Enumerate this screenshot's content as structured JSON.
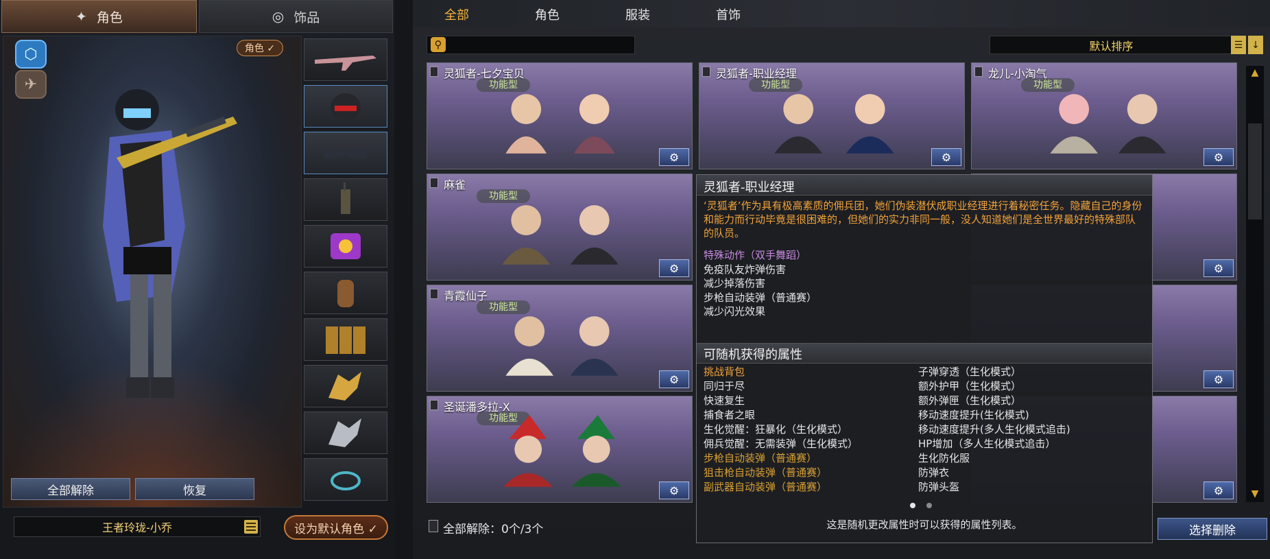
{
  "left_tabs": {
    "role": "角色",
    "accessory": "饰品"
  },
  "role_badge": "角色 ✓",
  "buttons": {
    "unequip_all": "全部解除",
    "restore": "恢复",
    "set_default": "设为默认角色 ✓",
    "select_delete": "选择删除"
  },
  "char_name": "王者玲珑-小乔",
  "nav": {
    "all": "全部",
    "role": "角色",
    "clothing": "服装",
    "accessory": "首饰"
  },
  "search": {
    "placeholder": ""
  },
  "sort": {
    "label": "默认排序"
  },
  "cards": [
    {
      "title": "灵狐者-七夕宝贝",
      "tag": "功能型"
    },
    {
      "title": "灵狐者-职业经理",
      "tag": "功能型"
    },
    {
      "title": "龙儿-小淘气",
      "tag": "功能型"
    },
    {
      "title": "麻雀",
      "tag": "功能型"
    },
    {
      "title": "青霞仙子",
      "tag": "功能型"
    },
    {
      "title": "圣诞潘多拉-X",
      "tag": "功能型"
    }
  ],
  "bottom_status": "全部解除：0个/3个",
  "tooltip": {
    "title": "灵狐者-职业经理",
    "description": "‘灵狐者’作为具有极高素质的佣兵团，她们伪装潜伏成职业经理进行着秘密任务。隐藏自己的身份和能力而行动毕竟是很困难的，但她们的实力非同一般，没人知道她们是全世界最好的特殊部队的队员。",
    "special_action": "特殊动作（双手舞蹈）",
    "features": [
      "免疫队友炸弹伤害",
      "减少掉落伤害",
      "步枪自动装弹（普通赛）",
      "减少闪光效果"
    ],
    "random_attr_title": "可随机获得的属性",
    "random_attrs_left": [
      {
        "text": "挑战背包",
        "color": "#f2a33a"
      },
      {
        "text": "同归于尽",
        "color": "#e6e6e6"
      },
      {
        "text": "快速复生",
        "color": "#e6e6e6"
      },
      {
        "text": "捕食者之眼",
        "color": "#e6e6e6"
      },
      {
        "text": "生化觉醒：狂暴化（生化模式）",
        "color": "#e6e6e6"
      },
      {
        "text": "佣兵觉醒：无需装弹（生化模式）",
        "color": "#e6e6e6"
      },
      {
        "text": "步枪自动装弹（普通赛）",
        "color": "#d9a033"
      },
      {
        "text": "狙击枪自动装弹（普通赛）",
        "color": "#d9a033"
      },
      {
        "text": "副武器自动装弹（普通赛）",
        "color": "#d9a033"
      }
    ],
    "random_attrs_right": [
      {
        "text": "子弹穿透（生化模式）",
        "color": "#e6e6e6"
      },
      {
        "text": "额外护甲（生化模式）",
        "color": "#e6e6e6"
      },
      {
        "text": "额外弹匣（生化模式）",
        "color": "#e6e6e6"
      },
      {
        "text": "移动速度提升(生化模式)",
        "color": "#e6e6e6"
      },
      {
        "text": "移动速度提升(多人生化模式追击)",
        "color": "#e6e6e6"
      },
      {
        "text": "HP增加（多人生化模式追击）",
        "color": "#e6e6e6"
      },
      {
        "text": "生化防化服",
        "color": "#e6e6e6"
      },
      {
        "text": "防弹衣",
        "color": "#e6e6e6"
      },
      {
        "text": "防弹头盔",
        "color": "#e6e6e6"
      }
    ],
    "footer": "这是随机更改属性时可以获得的属性列表。"
  }
}
